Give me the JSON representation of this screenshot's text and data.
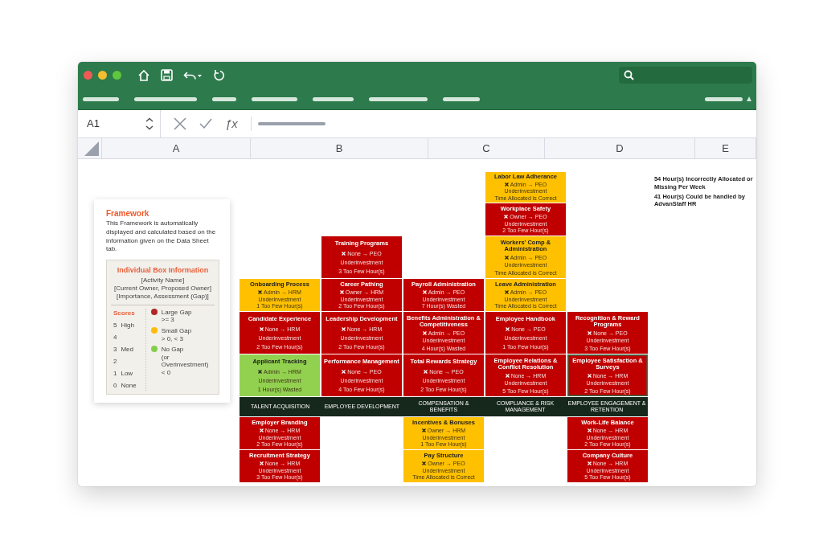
{
  "name_box": "A1",
  "formula_icon": "ƒx",
  "columns": [
    "A",
    "B",
    "C",
    "D",
    "E"
  ],
  "framework_panel": {
    "title": "Framework",
    "description": "This Framework is automatically displayed and calculated based on the information given on the Data Sheet tab.",
    "legend": {
      "title": "Individual Box Information",
      "lines": [
        "[Activity Name]",
        "[Current Owner, Proposed Owner]",
        "[Importance, Assessment (Gap)]"
      ],
      "scores_title": "Scores",
      "scores": [
        {
          "value": "5",
          "label": "High"
        },
        {
          "value": "4"
        },
        {
          "value": "3",
          "label": "Med"
        },
        {
          "value": "2"
        },
        {
          "value": "1",
          "label": "Low"
        },
        {
          "value": "0",
          "label": "None"
        }
      ],
      "gaps": [
        {
          "color": "#b02828",
          "lines": [
            "Large Gap",
            ">= 3"
          ]
        },
        {
          "color": "#fbbd08",
          "lines": [
            "Small Gap",
            "> 0, < 3"
          ]
        },
        {
          "color": "#84cf4a",
          "lines": [
            "No Gap",
            "(or Overinvestment)",
            "< 0"
          ]
        }
      ]
    }
  },
  "notes": [
    "54 Hour(s) Incorrectly Allocated or Missing Per Week",
    "41 Hour(s) Could be handled by AdvanStaff HR"
  ],
  "categories": [
    {
      "name": "TALENT ACQUISITION",
      "above": [
        {
          "title": "Onboarding Process",
          "owner_change": "Admin → HRM",
          "assessment": "Underinvestment",
          "hours": "1 Too Few Hour(s)",
          "color": "#ffc000",
          "selected": false
        },
        {
          "title": "Candidate Experience",
          "owner_change": "None → HRM",
          "assessment": "Underinvestment",
          "hours": "2 Too Few Hour(s)",
          "color": "#c00000",
          "selected": false
        },
        {
          "title": "Applicant Tracking",
          "owner_change": "Admin → HRM",
          "assessment": "Underinvestment",
          "hours": "1 Hour(s) Wasted",
          "color": "#92d050",
          "selected": false
        }
      ],
      "below": [
        {
          "title": "Employer Branding",
          "owner_change": "None → HRM",
          "assessment": "Underinvestment",
          "hours": "2 Too Few Hour(s)",
          "color": "#c00000",
          "selected": false
        },
        {
          "title": "Recruitment Strategy",
          "owner_change": "None → HRM",
          "assessment": "Underinvestment",
          "hours": "3 Too Few Hour(s)",
          "color": "#c00000",
          "selected": false
        }
      ]
    },
    {
      "name": "EMPLOYEE DEVELOPMENT",
      "above": [
        {
          "title": "Training Programs",
          "owner_change": "None → PEO",
          "assessment": "Underinvestment",
          "hours": "3 Too Few Hour(s)",
          "color": "#c00000",
          "selected": false
        },
        {
          "title": "Career Pathing",
          "owner_change": "Owner → HRM",
          "assessment": "Underinvestment",
          "hours": "2 Too Few Hour(s)",
          "color": "#c00000",
          "selected": false
        },
        {
          "title": "Leadership Development",
          "owner_change": "None → HRM",
          "assessment": "Underinvestment",
          "hours": "2 Too Few Hour(s)",
          "color": "#c00000",
          "selected": false
        },
        {
          "title": "Performance Management",
          "owner_change": "None → PEO",
          "assessment": "Underinvestment",
          "hours": "4 Too Few Hour(s)",
          "color": "#c00000",
          "selected": false
        }
      ]
    },
    {
      "name": "COMPENSATION & BENEFITS",
      "above": [
        {
          "title": "Payroll Administration",
          "owner_change": "Admin → PEO",
          "assessment": "Underinvestment",
          "hours": "7 Hour(s) Wasted",
          "color": "#c00000",
          "selected": false
        },
        {
          "title": "Benefits Administration & Competitiveness",
          "owner_change": "Admin → PEO",
          "assessment": "Underinvestment",
          "hours": "4 Hour(s) Wasted",
          "color": "#c00000",
          "selected": false
        },
        {
          "title": "Total Rewards Strategy",
          "owner_change": "None → PEO",
          "assessment": "Underinvestment",
          "hours": "2 Too Few Hour(s)",
          "color": "#c00000",
          "selected": false
        }
      ],
      "below": [
        {
          "title": "Incentives & Bonuses",
          "owner_change": "Owner → HRM",
          "assessment": "Underinvestment",
          "hours": "1 Too Few Hour(s)",
          "color": "#ffc000",
          "selected": false
        },
        {
          "title": "Pay Structure",
          "owner_change": "Owner → PEO",
          "assessment": "Underinvestment",
          "hours": "Time Allocated is Correct",
          "color": "#ffc000",
          "selected": false
        }
      ]
    },
    {
      "name": "COMPLIANCE & RISK MANAGEMENT",
      "above": [
        {
          "title": "Labor Law Adherance",
          "owner_change": "Admin → PEO",
          "assessment": "Underinvestment",
          "hours": "Time Allocated is Correct",
          "color": "#ffc000",
          "selected": false
        },
        {
          "title": "Workplace Safety",
          "owner_change": "Owner → PEO",
          "assessment": "Underinvestment",
          "hours": "2 Too Few Hour(s)",
          "color": "#c00000",
          "selected": false
        },
        {
          "title": "Workers' Comp & Administration",
          "owner_change": "Admin → PEO",
          "assessment": "Underinvestment",
          "hours": "Time Allocated is Correct",
          "color": "#ffc000",
          "selected": false
        },
        {
          "title": "Leave Administration",
          "owner_change": "Admin → PEO",
          "assessment": "Underinvestment",
          "hours": "Time Allocated is Correct",
          "color": "#ffc000",
          "selected": false
        },
        {
          "title": "Employee Handbook",
          "owner_change": "None → PEO",
          "assessment": "Underinvestment",
          "hours": "1 Too Few Hour(s)",
          "color": "#c00000",
          "selected": false
        },
        {
          "title": "Employee Relations & Conflict Resolution",
          "owner_change": "None → HRM",
          "assessment": "Underinvestment",
          "hours": "5 Too Few Hour(s)",
          "color": "#c00000",
          "selected": false
        }
      ]
    },
    {
      "name": "EMPLOYEE ENGAGEMENT & RETENTION",
      "above": [
        {
          "title": "Recognition & Reward Programs",
          "owner_change": "None → PEO",
          "assessment": "Underinvestment",
          "hours": "3 Too Few Hour(s)",
          "color": "#c00000",
          "selected": false
        },
        {
          "title": "Employee Satisfaction & Surveys",
          "owner_change": "None → HRM",
          "assessment": "Underinvestment",
          "hours": "2 Too Few Hour(s)",
          "color": "#c00000",
          "selected": true
        }
      ],
      "below": [
        {
          "title": "Work-Life Balance",
          "owner_change": "None → HRM",
          "assessment": "Underinvestment",
          "hours": "2 Too Few Hour(s)",
          "color": "#c00000",
          "selected": false
        },
        {
          "title": "Company Culture",
          "owner_change": "None → HRM",
          "assessment": "Underinvestment",
          "hours": "5 Too Few Hour(s)",
          "color": "#c00000",
          "selected": false
        }
      ]
    }
  ]
}
